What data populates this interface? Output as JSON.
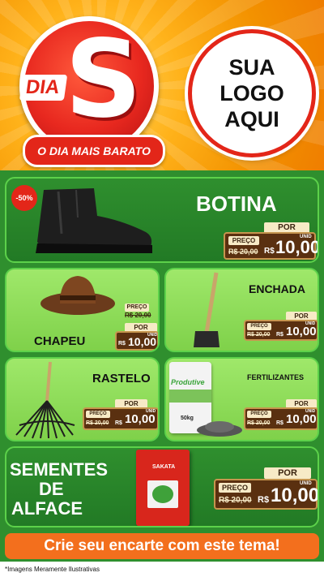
{
  "header": {
    "dia_word": "DIA",
    "dia_letter": "S",
    "slogan": "O DIA MAIS BARATO",
    "logo_lines": [
      "SUA",
      "LOGO",
      "AQUI"
    ]
  },
  "products": [
    {
      "name": "BOTINA",
      "discount": "-50%",
      "por": "POR",
      "preco_label": "PREÇO",
      "old_price": "R$ 20,00",
      "currency": "R$",
      "price": "10,00",
      "unit": "UNID"
    },
    {
      "name": "CHAPEU",
      "por": "POR",
      "preco_label": "PREÇO",
      "old_price": "R$ 20,00",
      "currency": "R$",
      "price": "10,00",
      "unit": "UNID"
    },
    {
      "name": "ENCHADA",
      "por": "POR",
      "preco_label": "PREÇO",
      "old_price": "R$ 20,00",
      "currency": "R$",
      "price": "10,00",
      "unit": "UNID"
    },
    {
      "name": "RASTELO",
      "por": "POR",
      "preco_label": "PREÇO",
      "old_price": "R$ 20,00",
      "currency": "R$",
      "price": "10,00",
      "unit": "UNID"
    },
    {
      "name": "FERTILIZANTES",
      "por": "POR",
      "preco_label": "PREÇO",
      "old_price": "R$ 20,00",
      "currency": "R$",
      "price": "10,00",
      "unit": "UNID",
      "bag_brand": "Produtive",
      "bag_weight": "50kg"
    },
    {
      "name_lines": [
        "SEMENTES",
        "DE",
        "ALFACE"
      ],
      "por": "POR",
      "preco_label": "PREÇO",
      "old_price": "R$ 20,00",
      "currency": "R$",
      "price": "10,00",
      "unit": "UNID",
      "pack_brand": "SAKATA"
    }
  ],
  "cta": "Crie seu encarte com este tema!",
  "footnote": "*Imagens Meramente Ilustrativas",
  "colors": {
    "accent_red": "#e32619",
    "green": "#2f8f2e",
    "light_green": "#8fdc5a",
    "orange": "#f36f1d",
    "price_brown": "#5a3010"
  }
}
